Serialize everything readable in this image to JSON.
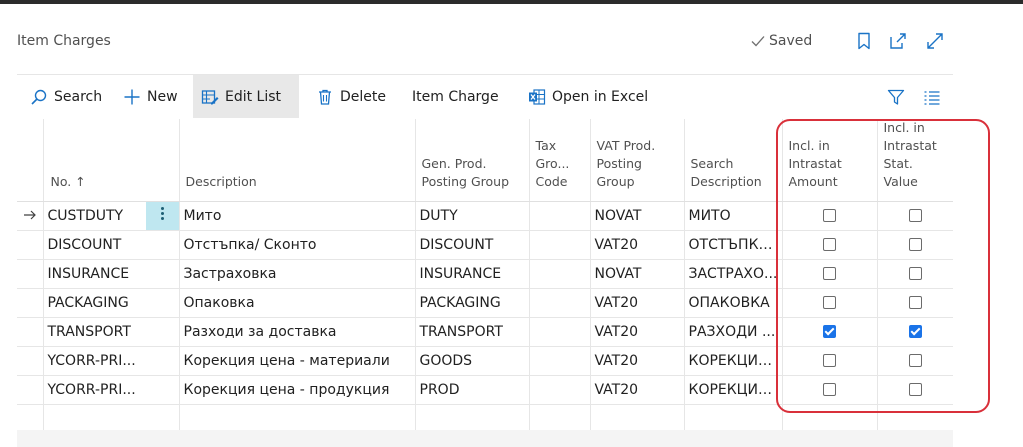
{
  "page": {
    "title": "Item Charges",
    "saved_label": "Saved"
  },
  "toolbar": {
    "search": "Search",
    "new": "New",
    "edit_list": "Edit List",
    "delete": "Delete",
    "item_charge": "Item Charge",
    "open_in_excel": "Open in Excel"
  },
  "columns": {
    "no": "No. ↑",
    "description": "Description",
    "gen_prod_1": "Gen. Prod.",
    "gen_prod_2": "Posting Group",
    "tax_1": "Tax",
    "tax_2": "Gro...",
    "tax_3": "Code",
    "vat_1": "VAT Prod.",
    "vat_2": "Posting",
    "vat_3": "Group",
    "search_1": "Search",
    "search_2": "Description",
    "incl_amt_1": "Incl. in",
    "incl_amt_2": "Intrastat",
    "incl_amt_3": "Amount",
    "incl_sv_1": "Incl. in",
    "incl_sv_2": "Intrastat",
    "incl_sv_3": "Stat. Value"
  },
  "rows": [
    {
      "no": "CUSTDUTY",
      "description": "Мито",
      "gen_prod": "DUTY",
      "tax": "",
      "vat": "NOVAT",
      "search": "МИТО",
      "incl_amount": false,
      "incl_stat_value": false
    },
    {
      "no": "DISCOUNT",
      "description": "Отстъпка/ Сконто",
      "gen_prod": "DISCOUNT",
      "tax": "",
      "vat": "VAT20",
      "search": "ОТСТЪПКА...",
      "incl_amount": false,
      "incl_stat_value": false
    },
    {
      "no": "INSURANCE",
      "description": "Застраховка",
      "gen_prod": "INSURANCE",
      "tax": "",
      "vat": "NOVAT",
      "search": "ЗАСТРАХО...",
      "incl_amount": false,
      "incl_stat_value": false
    },
    {
      "no": "PACKAGING",
      "description": "Опаковка",
      "gen_prod": "PACKAGING",
      "tax": "",
      "vat": "VAT20",
      "search": "ОПАКОВКА",
      "incl_amount": false,
      "incl_stat_value": false
    },
    {
      "no": "TRANSPORT",
      "description": "Разходи за доставка",
      "gen_prod": "TRANSPORT",
      "tax": "",
      "vat": "VAT20",
      "search": "РАЗХОДИ ...",
      "incl_amount": true,
      "incl_stat_value": true
    },
    {
      "no": "YCORR-PRI...",
      "description": "Корекция цена - материали",
      "gen_prod": "GOODS",
      "tax": "",
      "vat": "VAT20",
      "search": "КОРЕКЦИЯ ...",
      "incl_amount": false,
      "incl_stat_value": false
    },
    {
      "no": "YCORR-PRI...",
      "description": "Корекция цена - продукция",
      "gen_prod": "PROD",
      "tax": "",
      "vat": "VAT20",
      "search": "КОРЕКЦИЯ ...",
      "incl_amount": false,
      "incl_stat_value": false
    }
  ],
  "colors": {
    "accent": "#1a73e8",
    "highlight": "#d9303a",
    "selected_cell": "#bfe7f0"
  }
}
